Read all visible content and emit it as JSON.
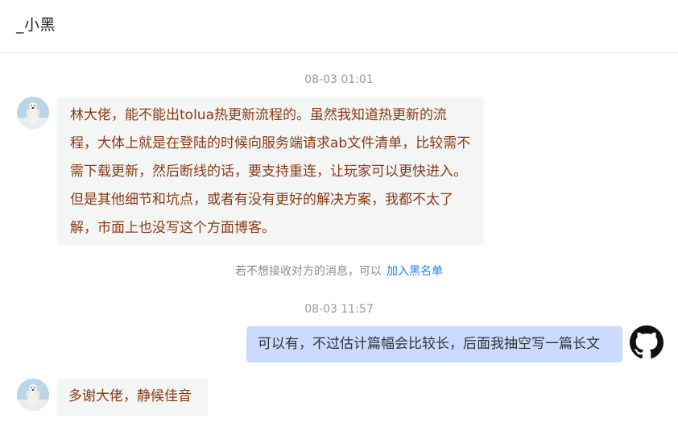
{
  "header": {
    "title": "_小黑"
  },
  "messages": [
    {
      "time": "08-03 01:01",
      "text": "林大佬，能不能出tolua热更新流程的。虽然我知道热更新的流程，大体上就是在登陆的时候向服务端请求ab文件清单，比较需不需下载更新，然后断线的话，要支持重连，让玩家可以更快进入。但是其他细节和坑点，或者有没有更好的解决方案，我都不太了解，市面上也没写这个方面博客。"
    },
    {
      "notice_text": "若不想接收对方的消息，可以",
      "notice_link": "加入黑名单"
    },
    {
      "time": "08-03 11:57",
      "text": "可以有，不过估计篇幅会比较长，后面我抽空写一篇长文"
    },
    {
      "text": "多谢大佬，静候佳音"
    }
  ],
  "colors": {
    "left_text": "#8a3a14",
    "right_bubble": "#cbdaff",
    "link": "#1e80ff"
  },
  "icons": {
    "self_avatar": "github-icon",
    "other_avatar": "polar-bear-avatar"
  }
}
